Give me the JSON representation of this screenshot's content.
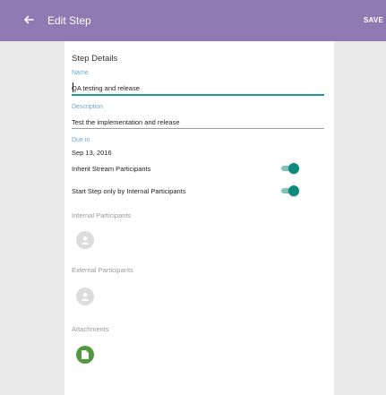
{
  "appbar": {
    "back_icon": "arrow-left-icon",
    "title": "Edit Step",
    "save_label": "SAVE",
    "color": "#8e79b3"
  },
  "card": {
    "section_title": "Step Details",
    "name": {
      "label": "Name",
      "value": "QA testing and release"
    },
    "description": {
      "label": "Description",
      "value": "Test the implementation and release"
    },
    "due": {
      "label": "Due in",
      "value": "Sep 13, 2016"
    },
    "toggles": [
      {
        "label": "Inherit Stream Participants",
        "on": true
      },
      {
        "label": "Start Step only by Internal Participants",
        "on": true
      }
    ],
    "internal": {
      "label": "Internal Participants",
      "icon": "add-person-icon"
    },
    "external": {
      "label": "External Participants",
      "icon": "add-person-icon"
    },
    "attachments": {
      "label": "Attachments",
      "icon": "add-file-icon"
    }
  },
  "colors": {
    "accent": "#1e9c8e",
    "label_blue": "#6aa7d3",
    "attach_green": "#4f9a3e"
  }
}
